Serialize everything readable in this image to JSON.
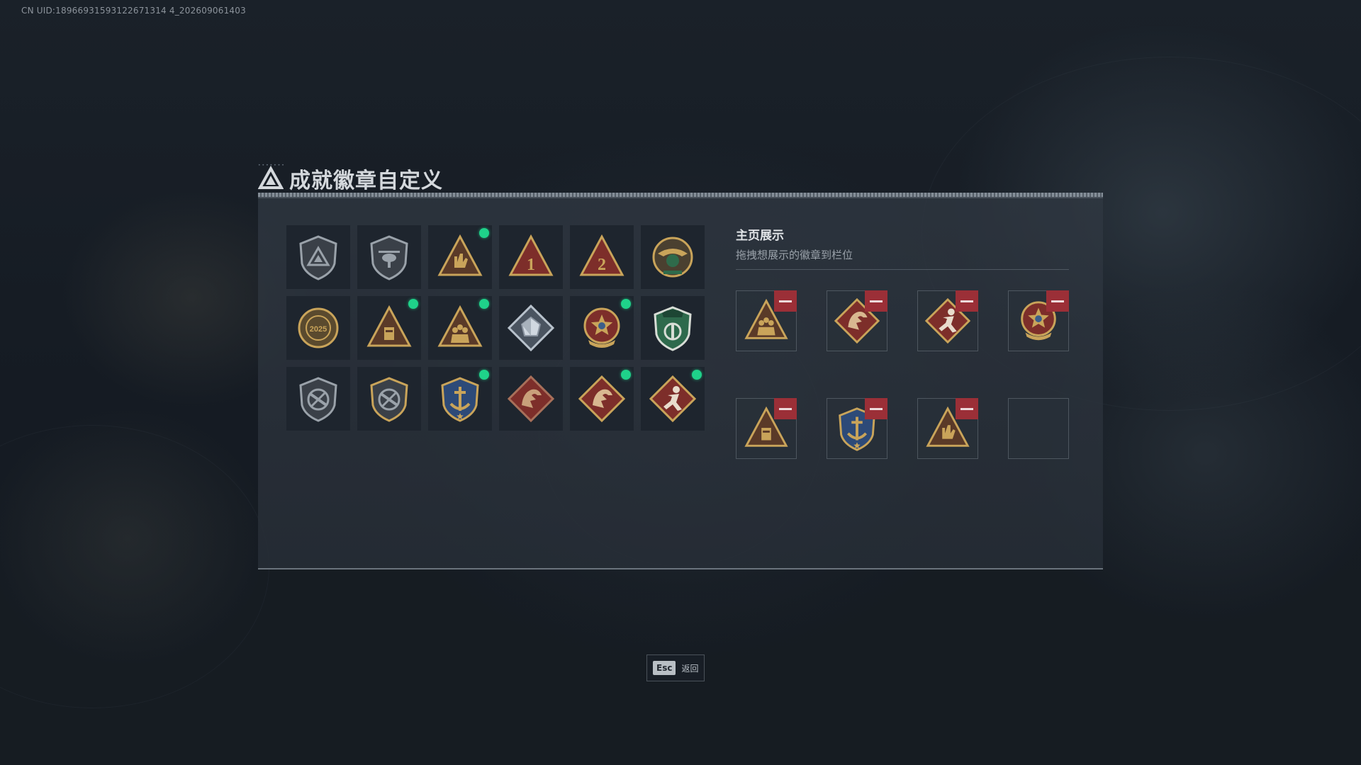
{
  "uid_text": "CN UID:18966931593122671314 4_202609061403",
  "title": "成就徽章自定义",
  "badges": [
    {
      "icon": "gray-shield-triangle-badge",
      "new": false
    },
    {
      "icon": "gray-helicopter-shield-badge",
      "new": false
    },
    {
      "icon": "gold-hand-sign-triangle-badge",
      "new": true
    },
    {
      "icon": "red-triangle-rank-1-badge",
      "new": false
    },
    {
      "icon": "red-triangle-rank-2-badge",
      "new": false
    },
    {
      "icon": "green-eagle-emblem-badge",
      "new": false
    },
    {
      "icon": "gold-2025-emblem-badge",
      "new": false
    },
    {
      "icon": "gold-triangle-crate-badge",
      "new": true
    },
    {
      "icon": "gold-triangle-squad-badge",
      "new": true
    },
    {
      "icon": "silver-crystal-badge",
      "new": false
    },
    {
      "icon": "red-star-medal-badge",
      "new": true
    },
    {
      "icon": "green-beret-shield-badge",
      "new": false
    },
    {
      "icon": "gray-no-rifle-shield-badge",
      "new": false
    },
    {
      "icon": "gold-no-rifle-shield-badge",
      "new": false
    },
    {
      "icon": "blue-anchor-crest-badge",
      "new": true
    },
    {
      "icon": "red-dragon-diamond-badge",
      "new": false
    },
    {
      "icon": "red-dragon-diamond-gold-badge",
      "new": true
    },
    {
      "icon": "red-runner-diamond-badge",
      "new": true
    }
  ],
  "showcase": {
    "title": "主页展示",
    "subtitle": "拖拽想展示的徽章到栏位",
    "slots": [
      {
        "icon": "gold-triangle-squad-badge",
        "filled": true
      },
      {
        "icon": "red-dragon-diamond-gold-badge",
        "filled": true
      },
      {
        "icon": "red-runner-diamond-badge",
        "filled": true
      },
      {
        "icon": "red-star-medal-badge",
        "filled": true
      },
      {
        "icon": "gold-triangle-crate-badge",
        "filled": true
      },
      {
        "icon": "blue-anchor-crest-badge",
        "filled": true
      },
      {
        "icon": "gold-hand-sign-triangle-badge",
        "filled": true
      },
      {
        "icon": "",
        "filled": false
      }
    ]
  },
  "footer": {
    "esc_key": "Esc",
    "esc_label": "返回"
  },
  "colors": {
    "new_indicator": "#1fd28a",
    "remove_button": "#9b2f37",
    "gold": "#c9a45a",
    "red_badge": "#7d2e2a"
  }
}
